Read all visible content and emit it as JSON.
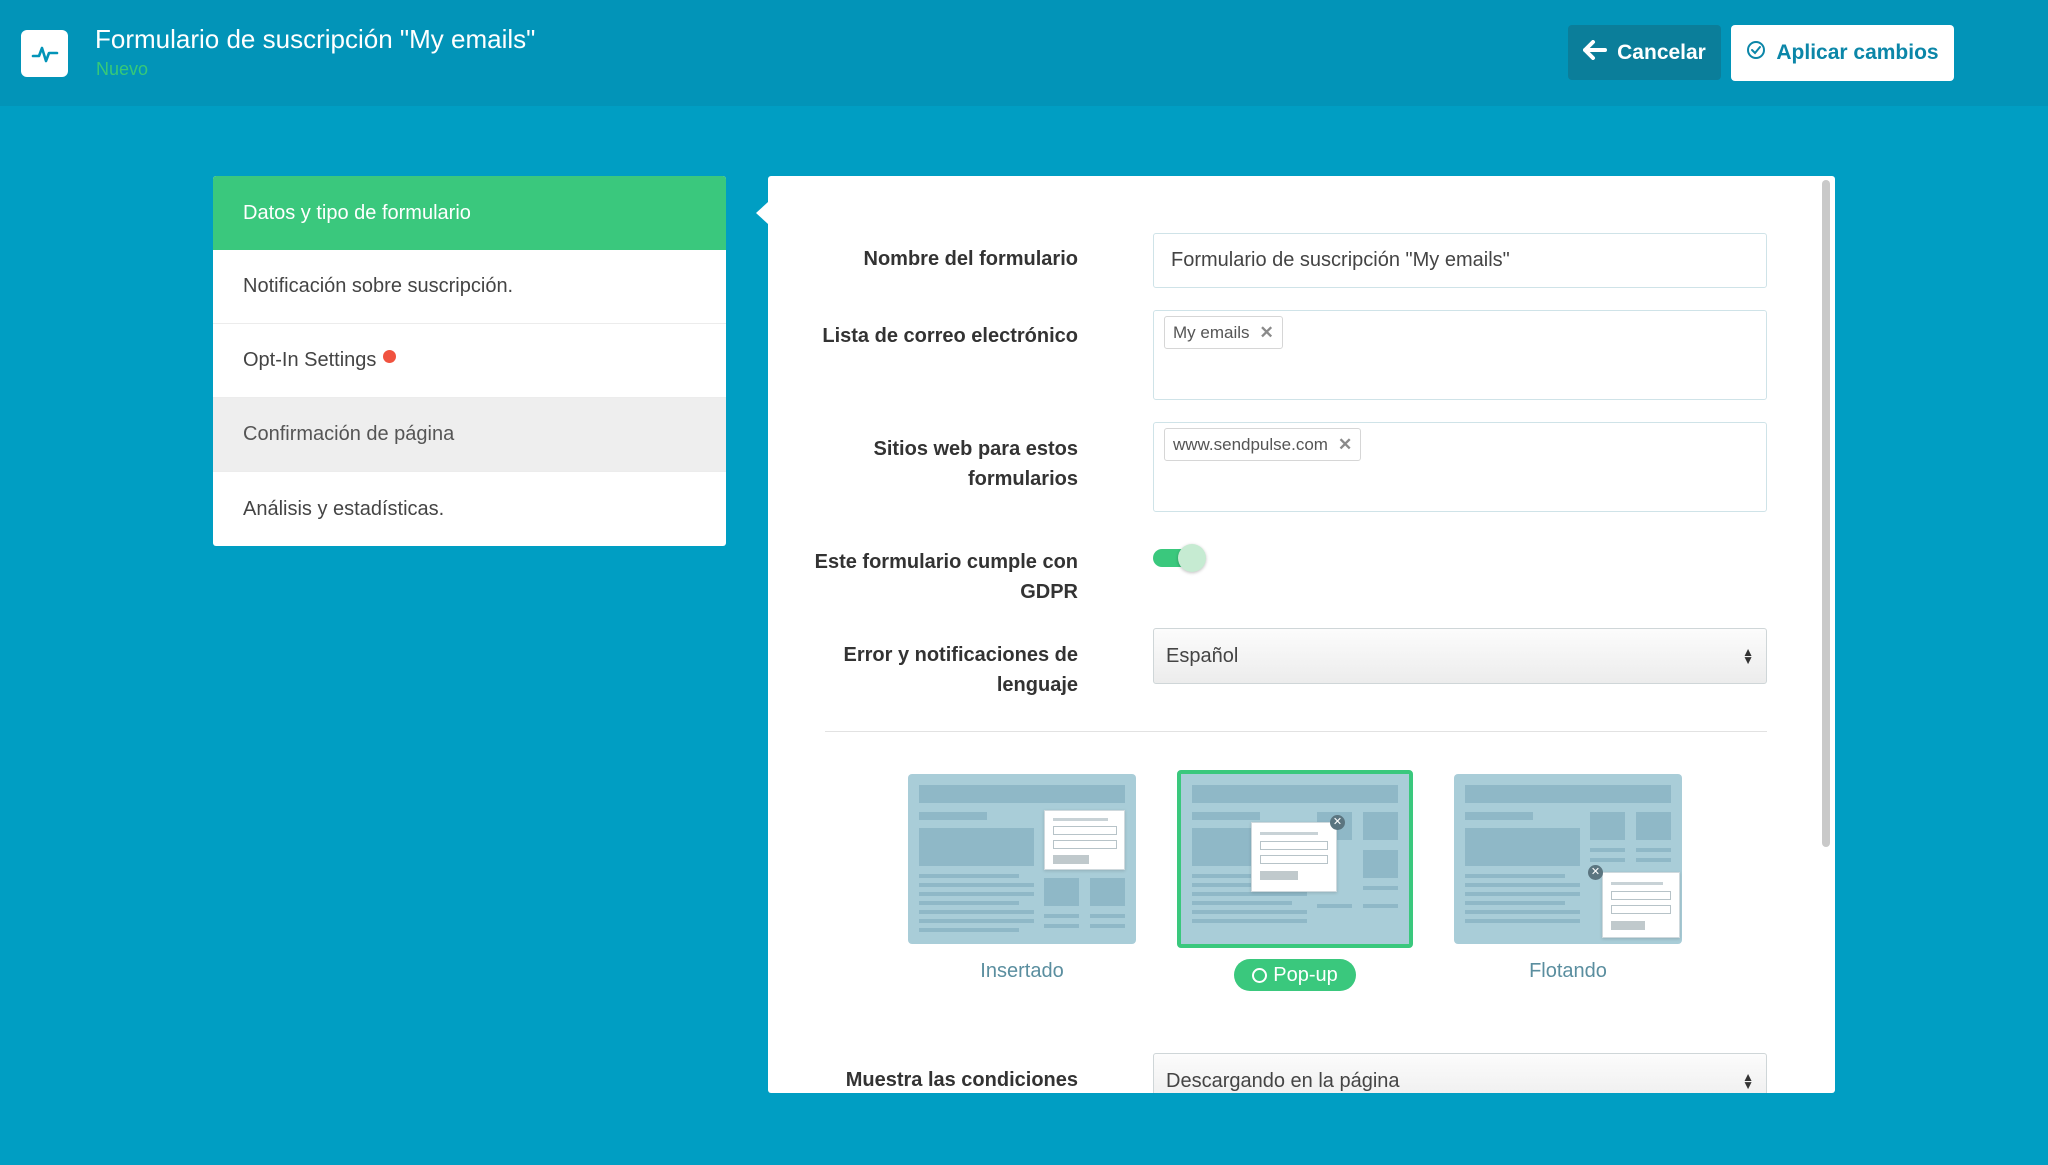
{
  "header": {
    "title": "Formulario de suscripción \"My emails\"",
    "status": "Nuevo",
    "cancel_label": "Cancelar",
    "apply_label": "Aplicar cambios"
  },
  "sidebar": {
    "items": [
      {
        "label": "Datos y tipo de formulario"
      },
      {
        "label": "Notificación sobre suscripción."
      },
      {
        "label": "Opt-In Settings"
      },
      {
        "label": "Confirmación de página"
      },
      {
        "label": "Análisis y estadísticas."
      }
    ]
  },
  "form": {
    "name_label": "Nombre del formulario",
    "name_value": "Formulario de suscripción \"My emails\"",
    "list_label": "Lista de correo electrónico",
    "list_tag": "My emails",
    "sites_label": "Sitios web para estos formularios",
    "sites_tag": "www.sendpulse.com",
    "gdpr_label": "Este formulario cumple con GDPR",
    "gdpr_enabled": true,
    "language_label": "Error y notificaciones de lenguaje",
    "language_value": "Español",
    "conditions_label": "Muestra las condiciones",
    "conditions_value": "Descargando en la página"
  },
  "form_types": [
    {
      "label": "Insertado"
    },
    {
      "label": "Pop-up",
      "selected": true
    },
    {
      "label": "Flotando"
    }
  ],
  "colors": {
    "accent": "#3ac87d",
    "background": "#009ec3",
    "header": "#0294b8",
    "alert_dot": "#f0523f"
  }
}
